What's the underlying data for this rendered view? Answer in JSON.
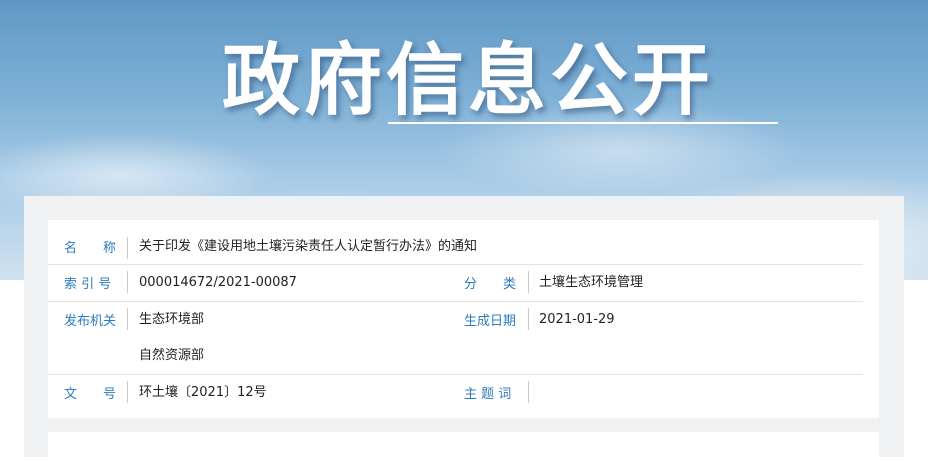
{
  "banner": {
    "title": "政府信息公开"
  },
  "info": {
    "name_label": "名　　称",
    "name_value": "关于印发《建设用地土壤污染责任人认定暂行办法》的通知",
    "index_label": "索 引 号",
    "index_value": "000014672/2021-00087",
    "category_label": "分　　类",
    "category_value": "土壤生态环境管理",
    "issuer_label": "发布机关",
    "issuer_values": [
      "生态环境部",
      "自然资源部"
    ],
    "date_label": "生成日期",
    "date_value": "2021-01-29",
    "docno_label": "文　　号",
    "docno_value": "环土壤〔2021〕12号",
    "subject_label": "主 题 词",
    "subject_value": ""
  },
  "colors": {
    "label": "#2e7bbf",
    "text": "#222222",
    "divider": "#e3e3e3"
  }
}
